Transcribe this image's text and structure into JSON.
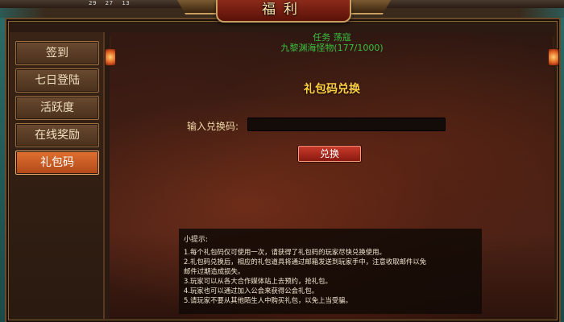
{
  "window": {
    "title": "福利"
  },
  "hud": {
    "items": [
      "29",
      "27",
      "13"
    ]
  },
  "sidebar": {
    "items": [
      {
        "label": "签到",
        "active": false
      },
      {
        "label": "七日登陆",
        "active": false
      },
      {
        "label": "活跃度",
        "active": false
      },
      {
        "label": "在线奖励",
        "active": false
      },
      {
        "label": "礼包码",
        "active": true
      }
    ]
  },
  "task": {
    "title": "任务  荡寇",
    "subtitle": "九黎渊海怪物(177/1000)"
  },
  "gift_code": {
    "heading": "礼包码兑换",
    "input_label": "输入兑换码:",
    "input_value": "",
    "input_placeholder": "",
    "redeem_label": "兑换"
  },
  "tips": {
    "title": "小提示:",
    "lines": [
      "1.每个礼包码仅可使用一次，请获得了礼包码的玩家尽快兑换使用。",
      "2.礼包码兑换后，相应的礼包道具将通过邮箱发送到玩家手中，注意收取邮件以免",
      "邮件过期造成损失。",
      "3.玩家可以从各大合作媒体站上去预约，抢礼包。",
      "4.玩家也可以通过加入公会来获得公会礼包。",
      "5.请玩家不要从其他陌生人中购买礼包，以免上当受骗。"
    ]
  },
  "colors": {
    "active_tab": "#e07030",
    "task_text": "#3ac040",
    "heading": "#ffd040",
    "redeem_button": "#c83a2a"
  }
}
